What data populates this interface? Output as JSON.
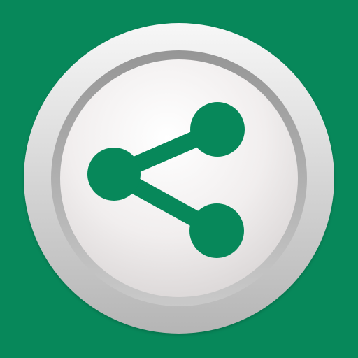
{
  "app": {
    "icon_name": "share-icon"
  },
  "colors": {
    "background": "#07885A",
    "button_outer_light": "#F7F7F7",
    "button_outer_dark": "#B5B5B5",
    "button_groove_dark": "#969696",
    "button_inner_light": "#FFFFFF",
    "button_inner_mid": "#F1EEEE",
    "button_inner_dark": "#D7D3D3",
    "glyph": "#07885A"
  }
}
